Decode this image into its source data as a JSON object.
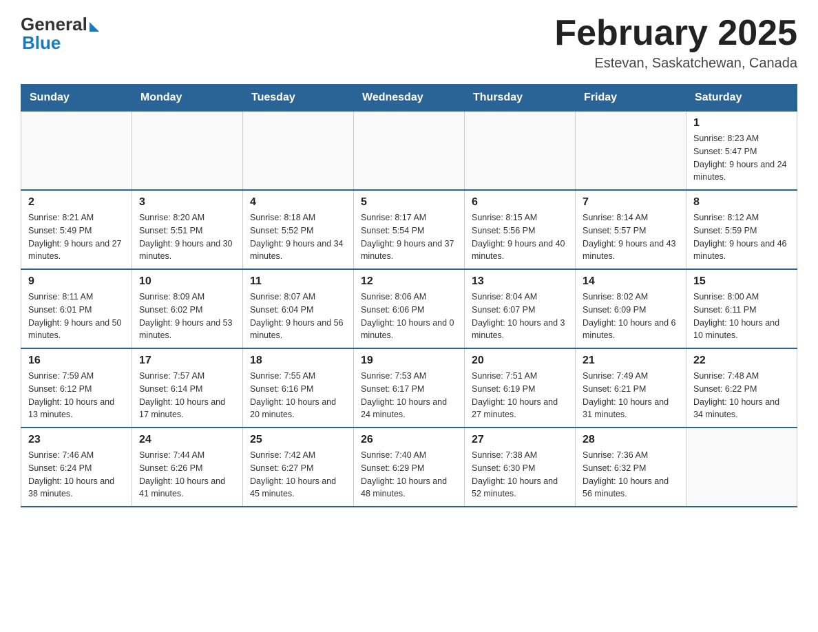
{
  "header": {
    "logo_general": "General",
    "logo_blue": "Blue",
    "month_title": "February 2025",
    "location": "Estevan, Saskatchewan, Canada"
  },
  "days_of_week": [
    "Sunday",
    "Monday",
    "Tuesday",
    "Wednesday",
    "Thursday",
    "Friday",
    "Saturday"
  ],
  "weeks": [
    [
      {
        "day": "",
        "info": ""
      },
      {
        "day": "",
        "info": ""
      },
      {
        "day": "",
        "info": ""
      },
      {
        "day": "",
        "info": ""
      },
      {
        "day": "",
        "info": ""
      },
      {
        "day": "",
        "info": ""
      },
      {
        "day": "1",
        "info": "Sunrise: 8:23 AM\nSunset: 5:47 PM\nDaylight: 9 hours and 24 minutes."
      }
    ],
    [
      {
        "day": "2",
        "info": "Sunrise: 8:21 AM\nSunset: 5:49 PM\nDaylight: 9 hours and 27 minutes."
      },
      {
        "day": "3",
        "info": "Sunrise: 8:20 AM\nSunset: 5:51 PM\nDaylight: 9 hours and 30 minutes."
      },
      {
        "day": "4",
        "info": "Sunrise: 8:18 AM\nSunset: 5:52 PM\nDaylight: 9 hours and 34 minutes."
      },
      {
        "day": "5",
        "info": "Sunrise: 8:17 AM\nSunset: 5:54 PM\nDaylight: 9 hours and 37 minutes."
      },
      {
        "day": "6",
        "info": "Sunrise: 8:15 AM\nSunset: 5:56 PM\nDaylight: 9 hours and 40 minutes."
      },
      {
        "day": "7",
        "info": "Sunrise: 8:14 AM\nSunset: 5:57 PM\nDaylight: 9 hours and 43 minutes."
      },
      {
        "day": "8",
        "info": "Sunrise: 8:12 AM\nSunset: 5:59 PM\nDaylight: 9 hours and 46 minutes."
      }
    ],
    [
      {
        "day": "9",
        "info": "Sunrise: 8:11 AM\nSunset: 6:01 PM\nDaylight: 9 hours and 50 minutes."
      },
      {
        "day": "10",
        "info": "Sunrise: 8:09 AM\nSunset: 6:02 PM\nDaylight: 9 hours and 53 minutes."
      },
      {
        "day": "11",
        "info": "Sunrise: 8:07 AM\nSunset: 6:04 PM\nDaylight: 9 hours and 56 minutes."
      },
      {
        "day": "12",
        "info": "Sunrise: 8:06 AM\nSunset: 6:06 PM\nDaylight: 10 hours and 0 minutes."
      },
      {
        "day": "13",
        "info": "Sunrise: 8:04 AM\nSunset: 6:07 PM\nDaylight: 10 hours and 3 minutes."
      },
      {
        "day": "14",
        "info": "Sunrise: 8:02 AM\nSunset: 6:09 PM\nDaylight: 10 hours and 6 minutes."
      },
      {
        "day": "15",
        "info": "Sunrise: 8:00 AM\nSunset: 6:11 PM\nDaylight: 10 hours and 10 minutes."
      }
    ],
    [
      {
        "day": "16",
        "info": "Sunrise: 7:59 AM\nSunset: 6:12 PM\nDaylight: 10 hours and 13 minutes."
      },
      {
        "day": "17",
        "info": "Sunrise: 7:57 AM\nSunset: 6:14 PM\nDaylight: 10 hours and 17 minutes."
      },
      {
        "day": "18",
        "info": "Sunrise: 7:55 AM\nSunset: 6:16 PM\nDaylight: 10 hours and 20 minutes."
      },
      {
        "day": "19",
        "info": "Sunrise: 7:53 AM\nSunset: 6:17 PM\nDaylight: 10 hours and 24 minutes."
      },
      {
        "day": "20",
        "info": "Sunrise: 7:51 AM\nSunset: 6:19 PM\nDaylight: 10 hours and 27 minutes."
      },
      {
        "day": "21",
        "info": "Sunrise: 7:49 AM\nSunset: 6:21 PM\nDaylight: 10 hours and 31 minutes."
      },
      {
        "day": "22",
        "info": "Sunrise: 7:48 AM\nSunset: 6:22 PM\nDaylight: 10 hours and 34 minutes."
      }
    ],
    [
      {
        "day": "23",
        "info": "Sunrise: 7:46 AM\nSunset: 6:24 PM\nDaylight: 10 hours and 38 minutes."
      },
      {
        "day": "24",
        "info": "Sunrise: 7:44 AM\nSunset: 6:26 PM\nDaylight: 10 hours and 41 minutes."
      },
      {
        "day": "25",
        "info": "Sunrise: 7:42 AM\nSunset: 6:27 PM\nDaylight: 10 hours and 45 minutes."
      },
      {
        "day": "26",
        "info": "Sunrise: 7:40 AM\nSunset: 6:29 PM\nDaylight: 10 hours and 48 minutes."
      },
      {
        "day": "27",
        "info": "Sunrise: 7:38 AM\nSunset: 6:30 PM\nDaylight: 10 hours and 52 minutes."
      },
      {
        "day": "28",
        "info": "Sunrise: 7:36 AM\nSunset: 6:32 PM\nDaylight: 10 hours and 56 minutes."
      },
      {
        "day": "",
        "info": ""
      }
    ]
  ]
}
